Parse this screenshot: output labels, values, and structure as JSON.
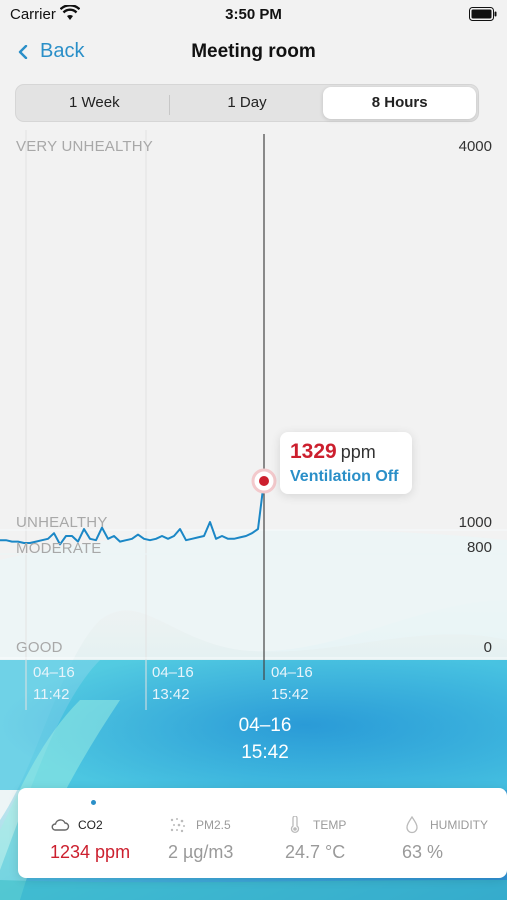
{
  "status_bar": {
    "carrier": "Carrier",
    "time": "3:50 PM"
  },
  "nav": {
    "back_label": "Back",
    "title": "Meeting room"
  },
  "range_tabs": [
    "1 Week",
    "1 Day",
    "8 Hours"
  ],
  "selected_range": "8 Hours",
  "chart": {
    "levels": {
      "very_unhealthy": "VERY UNHEALTHY",
      "unhealthy": "UNHEALTHY",
      "moderate": "MODERATE",
      "good": "GOOD"
    },
    "ticks": {
      "t4000": "4000",
      "t1000": "1000",
      "t800": "800",
      "t0": "0"
    },
    "x_labels": [
      {
        "date": "04–16",
        "time": "11:42"
      },
      {
        "date": "04–16",
        "time": "13:42"
      },
      {
        "date": "04–16",
        "time": "15:42"
      }
    ],
    "selected": {
      "date": "04–16",
      "time": "15:42"
    },
    "tooltip": {
      "value": "1329",
      "unit": "ppm",
      "state": "Ventilation Off"
    }
  },
  "chart_data": {
    "type": "line",
    "ylim": [
      0,
      4000
    ],
    "y_ticks": [
      4000,
      1000,
      800,
      0
    ],
    "series": [
      {
        "values": [
          870,
          870,
          860,
          860,
          850,
          850,
          860,
          870,
          880,
          920,
          840,
          900,
          900,
          860,
          950,
          880,
          870,
          960,
          880,
          900,
          860,
          870,
          880,
          910,
          880,
          870,
          880,
          900,
          880,
          900,
          950,
          870,
          880,
          890,
          900,
          1000,
          880,
          900,
          880,
          880,
          890,
          900,
          920,
          950,
          1329
        ]
      }
    ],
    "highlight": {
      "value": 1329,
      "time": "15:42"
    }
  },
  "metrics": [
    {
      "name": "CO2",
      "value": "1234 ppm",
      "icon": "cloud-icon"
    },
    {
      "name": "PM2.5",
      "value": "2 µg/m3",
      "icon": "particles-icon"
    },
    {
      "name": "TEMP",
      "value": "24.7 °C",
      "icon": "thermometer-icon"
    },
    {
      "name": "HUMIDITY",
      "value": "63 %",
      "icon": "droplet-icon"
    }
  ],
  "colors": {
    "accent": "#2a8fc8",
    "alert": "#cc1f2e",
    "line": "#1b87c6"
  }
}
